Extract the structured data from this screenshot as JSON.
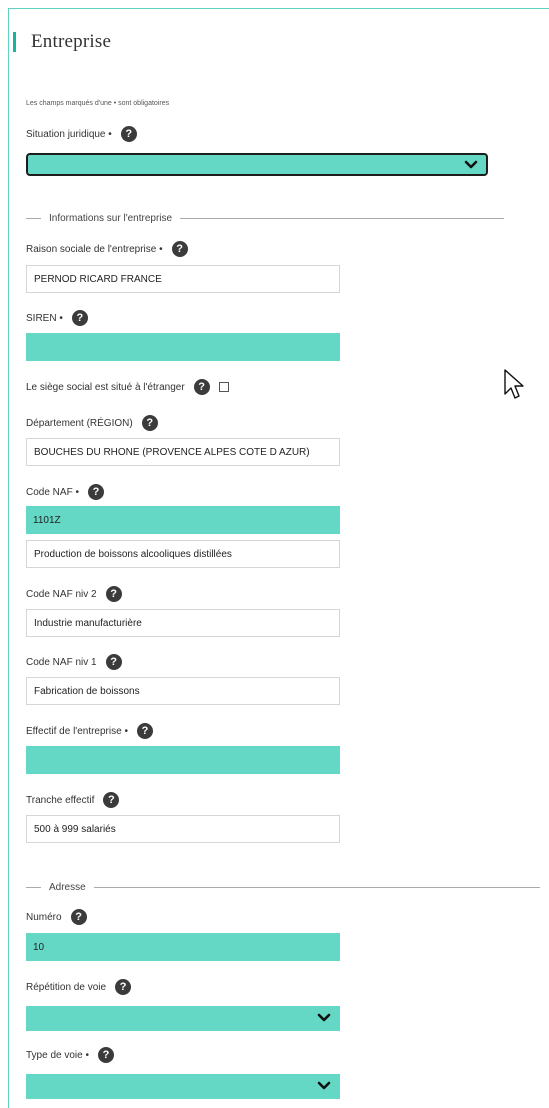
{
  "header": {
    "title": "Entreprise"
  },
  "note": "Les champs marqués d'une • sont obligatoires",
  "situation": {
    "label": "Situation juridique •",
    "value": ""
  },
  "section_info": "Informations sur l'entreprise",
  "raison_sociale": {
    "label": "Raison sociale de l'entreprise •",
    "value": "PERNOD RICARD FRANCE"
  },
  "siren": {
    "label": "SIREN •",
    "value": ""
  },
  "siege": {
    "label": "Le siège social est situé à l'étranger",
    "checked": false
  },
  "departement": {
    "label": "Département (RÉGION)",
    "value": "BOUCHES DU RHONE (PROVENCE ALPES COTE D AZUR)"
  },
  "code_naf": {
    "label": "Code NAF •",
    "code": "1101Z",
    "description": "Production de boissons alcooliques distillées"
  },
  "naf_niv2": {
    "label": "Code NAF niv 2",
    "value": "Industrie manufacturière"
  },
  "naf_niv1": {
    "label": "Code NAF niv 1",
    "value": "Fabrication de boissons"
  },
  "effectif": {
    "label": "Effectif de l'entreprise •",
    "value": ""
  },
  "tranche": {
    "label": "Tranche effectif",
    "value": "500 à 999 salariés"
  },
  "section_adresse": "Adresse",
  "numero": {
    "label": "Numéro",
    "value": "10"
  },
  "repetition": {
    "label": "Répétition de voie",
    "value": ""
  },
  "type_voie": {
    "label": "Type de voie •",
    "value": ""
  },
  "help_glyph": "?",
  "colors": {
    "accent": "#19b49c",
    "field_teal": "#64d8c4",
    "help_bg": "#3b3b3b"
  }
}
